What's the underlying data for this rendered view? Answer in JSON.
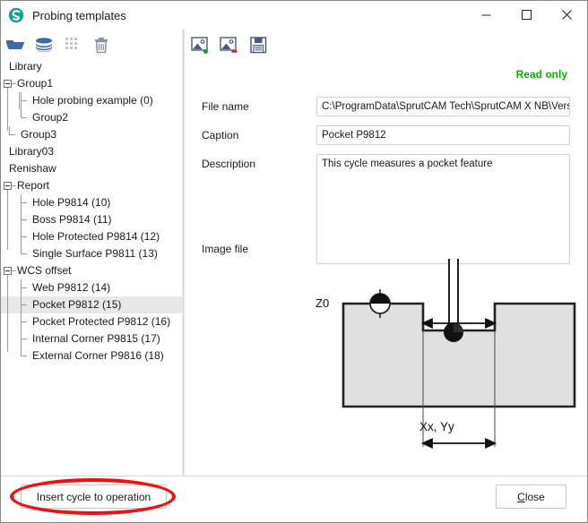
{
  "window": {
    "title": "Probing templates",
    "icon": "sprutcam-logo-icon",
    "controls": {
      "minimize": "─",
      "maximize": "□",
      "close": "✕"
    }
  },
  "left_toolbar": {
    "items": [
      {
        "name": "open-folder-icon",
        "label": "Open folder",
        "enabled": true
      },
      {
        "name": "library-stack-icon",
        "label": "Library",
        "enabled": true
      },
      {
        "name": "grid-icon",
        "label": "Grid",
        "enabled": false
      },
      {
        "name": "trash-icon",
        "label": "Delete",
        "enabled": true
      }
    ]
  },
  "right_toolbar": {
    "items": [
      {
        "name": "add-image-icon",
        "label": "Add image"
      },
      {
        "name": "remove-image-icon",
        "label": "Remove image"
      },
      {
        "name": "save-icon",
        "label": "Save"
      }
    ]
  },
  "tree": {
    "nodes": [
      {
        "label": "Library",
        "depth": 0,
        "expander": false,
        "selected": false
      },
      {
        "label": "Group1",
        "depth": 0,
        "expander": true,
        "selected": false
      },
      {
        "label": "Hole probing example (0)",
        "depth": 2,
        "expander": false,
        "selected": false
      },
      {
        "label": "Group2",
        "depth": 2,
        "expander": false,
        "selected": false
      },
      {
        "label": "Group3",
        "depth": 1,
        "expander": false,
        "selected": false
      },
      {
        "label": "Library03",
        "depth": 0,
        "expander": false,
        "selected": false
      },
      {
        "label": "Renishaw",
        "depth": 0,
        "expander": false,
        "selected": false
      },
      {
        "label": "Report",
        "depth": 0,
        "expander": true,
        "selected": false
      },
      {
        "label": "Hole P9814 (10)",
        "depth": 2,
        "expander": false,
        "selected": false
      },
      {
        "label": "Boss P9814 (11)",
        "depth": 2,
        "expander": false,
        "selected": false
      },
      {
        "label": "Hole Protected P9814 (12)",
        "depth": 2,
        "expander": false,
        "selected": false
      },
      {
        "label": "Single Surface P9811 (13)",
        "depth": 2,
        "expander": false,
        "selected": false
      },
      {
        "label": "WCS offset",
        "depth": 0,
        "expander": true,
        "selected": false
      },
      {
        "label": "Web P9812 (14)",
        "depth": 2,
        "expander": false,
        "selected": false
      },
      {
        "label": "Pocket P9812 (15)",
        "depth": 2,
        "expander": false,
        "selected": true
      },
      {
        "label": "Pocket Protected P9812 (16)",
        "depth": 2,
        "expander": false,
        "selected": false
      },
      {
        "label": "Internal Corner P9815 (17)",
        "depth": 2,
        "expander": false,
        "selected": false
      },
      {
        "label": "External Corner P9816 (18)",
        "depth": 2,
        "expander": false,
        "selected": false
      }
    ]
  },
  "details": {
    "read_only_label": "Read only",
    "read_only_color": "#00b400",
    "file_name_label": "File name",
    "file_name_value": "C:\\ProgramData\\SprutCAM Tech\\SprutCAM X NB\\Version",
    "caption_label": "Caption",
    "caption_value": "Pocket P9812",
    "description_label": "Description",
    "description_value": "This cycle measures a pocket feature",
    "image_file_label": "Image file"
  },
  "diagram": {
    "name": "pocket-probing-diagram",
    "z0_label": "Z0",
    "dimension_label": "Xx, Yy",
    "fill_color": "#e0e0e0",
    "stroke_color": "#222222"
  },
  "footer": {
    "insert_label": "Insert cycle to operation",
    "close_label_prefix": "",
    "close_accel": "C",
    "close_label_rest": "lose",
    "annotation_color": "#ee1111"
  }
}
